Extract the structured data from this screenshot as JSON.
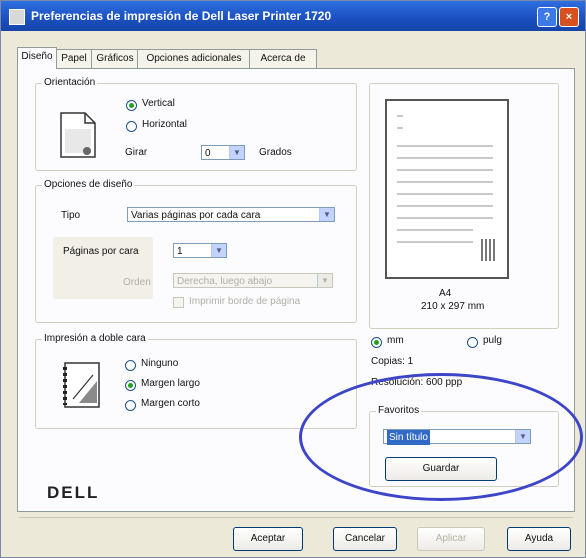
{
  "window": {
    "title": "Preferencias de impresión de Dell Laser Printer 1720",
    "help_label": "?",
    "close_label": "×"
  },
  "tabs": [
    {
      "label": "Diseño"
    },
    {
      "label": "Papel"
    },
    {
      "label": "Gráficos"
    },
    {
      "label": "Opciones adicionales"
    },
    {
      "label": "Acerca de"
    }
  ],
  "orientation": {
    "title": "Orientación",
    "portrait_label": "Vertical",
    "landscape_label": "Horizontal",
    "rotate_label": "Girar",
    "rotate_value": "0",
    "degrees_label": "Grados"
  },
  "layout_options": {
    "title": "Opciones de diseño",
    "type_label": "Tipo",
    "type_value": "Varias páginas por cada cara",
    "pages_per_side_label": "Páginas por cara",
    "pages_per_side_value": "1",
    "order_label": "Orden",
    "order_value": "Derecha, luego abajo",
    "border_label": "Imprimir borde de página"
  },
  "duplex": {
    "title": "Impresión a doble cara",
    "none_label": "Ninguno",
    "long_edge_label": "Margen largo",
    "short_edge_label": "Margen corto"
  },
  "preview": {
    "paper_name": "A4",
    "paper_size": "210 x 297 mm",
    "mm_label": "mm",
    "inch_label": "pulg",
    "copies_label": "Copias: 1",
    "resolution_label": "Resolución: 600 ppp"
  },
  "favorites": {
    "title": "Favoritos",
    "value": "Sin título",
    "save_label": "Guardar"
  },
  "brand": {
    "logo_text": "DELL"
  },
  "buttons": {
    "ok": "Aceptar",
    "cancel": "Cancelar",
    "apply": "Aplicar",
    "help": "Ayuda"
  }
}
